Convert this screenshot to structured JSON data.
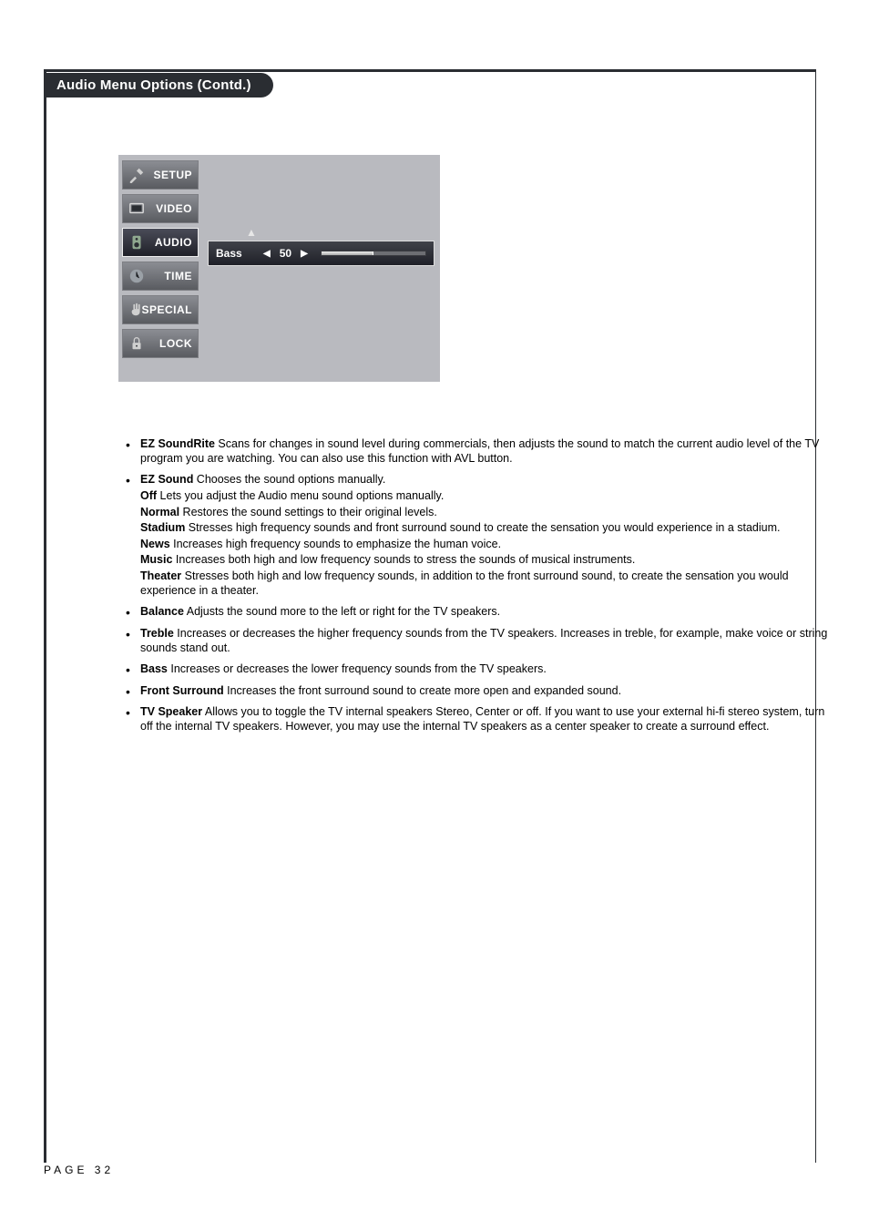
{
  "section_title": "Audio Menu Options (Contd.)",
  "osd": {
    "items": [
      {
        "label": "SETUP"
      },
      {
        "label": "VIDEO"
      },
      {
        "label": "AUDIO"
      },
      {
        "label": "TIME"
      },
      {
        "label": "SPECIAL"
      },
      {
        "label": "LOCK"
      }
    ],
    "selected_index": 2,
    "row_label": "Bass",
    "row_value": "50"
  },
  "bullets": {
    "ez_soundrite": {
      "name": "EZ SoundRite",
      "text": "  Scans for changes in sound level during commercials, then adjusts the sound to match the current audio level of the TV program you are watching. You can also use this function with AVL button."
    },
    "ez_sound": {
      "name": "EZ Sound",
      "text": "  Chooses the sound options manually.",
      "sub": [
        {
          "name": "Off",
          "text": "  Lets you adjust the Audio menu sound options manually."
        },
        {
          "name": "Normal",
          "text": "  Restores the sound settings to their original levels."
        },
        {
          "name": "Stadium",
          "text": "  Stresses high frequency sounds and front surround sound to create the sensation you would experience in a stadium."
        },
        {
          "name": "News",
          "text": "  Increases high frequency sounds to emphasize the human voice."
        },
        {
          "name": "Music",
          "text": "  Increases both high and low frequency sounds to stress the sounds of musical instruments."
        },
        {
          "name": "Theater",
          "text": "  Stresses both high and low frequency sounds, in addition to the front surround sound, to create the sensation you would experience in a theater."
        }
      ]
    },
    "balance": {
      "name": "Balance",
      "text": "  Adjusts the sound more to the left or right for the TV speakers."
    },
    "treble": {
      "name": "Treble",
      "text": "  Increases or decreases the higher frequency sounds from the TV speakers. Increases in treble, for example, make voice or string sounds stand out."
    },
    "bass": {
      "name": "Bass",
      "text": "  Increases or decreases the lower frequency sounds from the TV speakers."
    },
    "front_surround": {
      "name": "Front Surround",
      "text": "  Increases the front surround sound to create more open and expanded sound."
    },
    "tv_speaker": {
      "name": "TV Speaker",
      "text": "  Allows you to toggle the TV internal speakers Stereo, Center or off. If you want to use your external hi-fi stereo system, turn off the internal TV speakers. However, you may use the internal TV speakers as a center speaker to create a surround effect."
    }
  },
  "page_label": "PAGE 32"
}
